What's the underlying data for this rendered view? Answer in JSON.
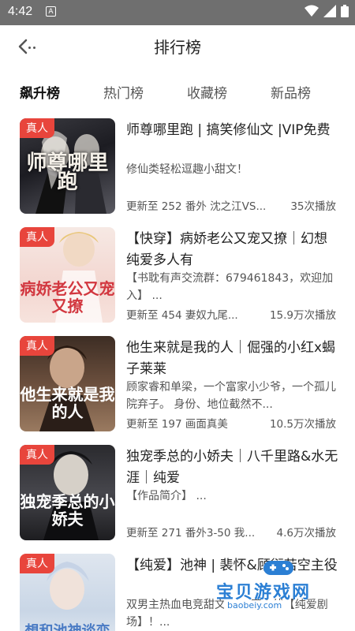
{
  "status_bar": {
    "time": "4:42",
    "notif_letter": "A"
  },
  "header": {
    "title": "排行榜"
  },
  "tabs": [
    "飙升榜",
    "热门榜",
    "收藏榜",
    "新品榜"
  ],
  "items": [
    {
      "badge": "真人",
      "title": "师尊哪里跑 | 搞笑修仙文 |VIP免费",
      "desc": "修仙类轻松逗趣小甜文！",
      "update": "更新至  252 番外 沈之江VS...",
      "plays": "35次播放",
      "cover_text": "师尊哪里跑"
    },
    {
      "badge": "真人",
      "title": "【快穿】病娇老公又宠又撩｜幻想纯爱多人有",
      "desc": "【书耽有声交流群：679461843，欢迎加入】 ...",
      "update": "更新至  454  妻奴九尾...",
      "plays": "15.9万次播放",
      "cover_text": "病娇老公又宠又撩",
      "cover_tag": "快穿"
    },
    {
      "badge": "真人",
      "title": "他生来就是我的人｜倔强的小红x蝎子莱莱",
      "desc": "顾家睿和单梁，一个富家小少爷，一个孤儿院弃子。 身份、地位截然不...",
      "update": "更新至  197 画面真美",
      "plays": "10.5万次播放",
      "cover_text": "他生来就是我的人"
    },
    {
      "badge": "真人",
      "title": "独宠季总的小娇夫｜八千里路&水无涯｜纯爱",
      "desc": "【作品简介】 ...",
      "update": "更新至  271  番外3-50 我...",
      "plays": "4.6万次播放",
      "cover_text": "独宠季总的小娇夫"
    },
    {
      "badge": "真人",
      "title": "【纯爱】池神 | 裴怀&顾衍若空主役",
      "desc": "双男主热血电竞甜文，... 家上线【纯爱剧场】！...",
      "cover_text": "想和池神谈恋爱"
    }
  ],
  "watermark": {
    "main": "宝贝游戏网",
    "sub": "baobeiy.com"
  },
  "colors": {
    "badge": "#e8453c",
    "status_bar": "#6f6f6f",
    "watermark": "#2b7fd4"
  }
}
